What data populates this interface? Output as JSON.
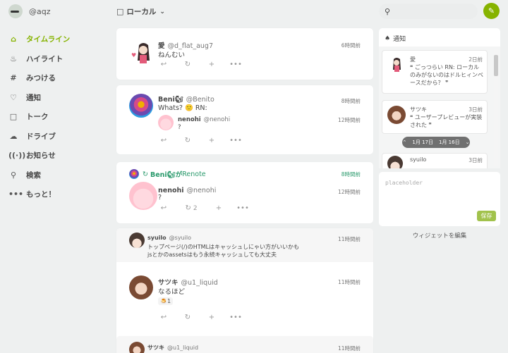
{
  "account": {
    "name": "@aqz"
  },
  "nav": [
    {
      "icon": "home-icon",
      "glyph": "⌂",
      "label": "タイムライン",
      "active": true
    },
    {
      "icon": "fire-icon",
      "glyph": "♨",
      "label": "ハイライト"
    },
    {
      "icon": "hashtag-icon",
      "glyph": "#",
      "label": "みつける"
    },
    {
      "icon": "bell-icon",
      "glyph": "🔔",
      "label": "通知"
    },
    {
      "icon": "chat-icon",
      "glyph": "💬",
      "label": "トーク"
    },
    {
      "icon": "cloud-icon",
      "glyph": "☁",
      "label": "ドライブ"
    },
    {
      "icon": "broadcast-icon",
      "glyph": "📡",
      "label": "お知らせ"
    },
    {
      "icon": "search-icon",
      "glyph": "🔍",
      "label": "検索"
    },
    {
      "icon": "more-icon",
      "glyph": "•••",
      "label": "もっと！"
    }
  ],
  "header": {
    "title": "ローカル"
  },
  "notes": [
    {
      "name": "愛",
      "acct": "@d_flat_aug7",
      "time": "6時間前",
      "text": "ねんむい"
    },
    {
      "name": "Beni🐿",
      "acct": "@Benito",
      "time": "8時間前",
      "text": "Whats? 🙂 RN:",
      "quote": {
        "name": "nenohi",
        "acct": "@nenohi",
        "time": "12時間前",
        "text": "?"
      }
    },
    {
      "renote_by": "Beni🐿が",
      "renote_suffix": "Renote",
      "time": "8時間前",
      "inner": {
        "name": "nenohi",
        "acct": "@nenohi",
        "time": "12時間前",
        "text": "?",
        "renotes": "2"
      }
    },
    {
      "reply": {
        "name": "syuilo",
        "acct": "@syuilo",
        "time": "11時間前",
        "text1": "トップページ(/)のHTMLはキャッシュしにゃい方がいいかも",
        "text2": "jsとかのassetsはもう永続キャッシュしても大丈夫"
      },
      "name": "サツキ",
      "acct": "@u1_liquid",
      "time": "11時間前",
      "text": "なるほど",
      "reaction": "🍮1"
    },
    {
      "name": "サツキ",
      "acct": "@u1_liquid",
      "time": "11時間前"
    }
  ],
  "notifications": {
    "title": "通知",
    "items": [
      {
        "name": "愛",
        "time": "2日前",
        "text": "❝ ごっつらい RN: ローカルのみがないのはドルヒィンベースだから？ ❞"
      },
      {
        "name": "サツキ",
        "time": "3日前",
        "text": "❝ ユーザープレビューが実装された ❞"
      },
      {
        "name": "syuilo",
        "time": "3日前",
        "text": ""
      }
    ],
    "date_prev": "1月 17日",
    "date_next": "1月 16日"
  },
  "memo": {
    "placeholder": "placeholder",
    "save_label": "保存"
  },
  "edit_widgets": "ウィジェットを編集",
  "colors": {
    "accent": "#86b300",
    "renote": "#2a9a6c"
  }
}
